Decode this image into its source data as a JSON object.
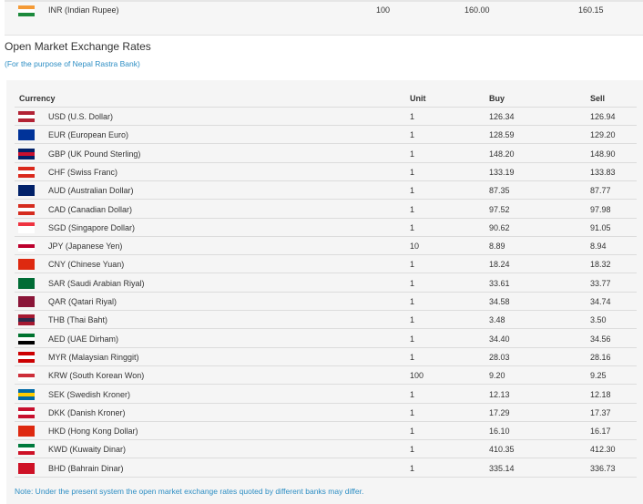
{
  "top_row": {
    "currency": "INR (Indian Rupee)",
    "unit": "100",
    "buy": "160.00",
    "sell": "160.15",
    "flag": [
      "#f49a36",
      "#ffffff",
      "#1c8a3c"
    ]
  },
  "title": "Open Market Exchange Rates",
  "subtitle": "(For the purpose of Nepal Rastra Bank)",
  "headers": {
    "currency": "Currency",
    "unit": "Unit",
    "buy": "Buy",
    "sell": "Sell"
  },
  "rows": [
    {
      "currency": "USD (U.S. Dollar)",
      "unit": "1",
      "buy": "126.34",
      "sell": "126.94",
      "flag": [
        "#b22234",
        "#ffffff",
        "#b22234"
      ]
    },
    {
      "currency": "EUR (European Euro)",
      "unit": "1",
      "buy": "128.59",
      "sell": "129.20",
      "flag": [
        "#003399",
        "#003399",
        "#003399"
      ]
    },
    {
      "currency": "GBP (UK Pound Sterling)",
      "unit": "1",
      "buy": "148.20",
      "sell": "148.90",
      "flag": [
        "#012169",
        "#c8102e",
        "#012169"
      ]
    },
    {
      "currency": "CHF (Swiss Franc)",
      "unit": "1",
      "buy": "133.19",
      "sell": "133.83",
      "flag": [
        "#da291c",
        "#ffffff",
        "#da291c"
      ]
    },
    {
      "currency": "AUD (Australian Dollar)",
      "unit": "1",
      "buy": "87.35",
      "sell": "87.77",
      "flag": [
        "#012169",
        "#012169",
        "#012169"
      ]
    },
    {
      "currency": "CAD (Canadian Dollar)",
      "unit": "1",
      "buy": "97.52",
      "sell": "97.98",
      "flag": [
        "#d52b1e",
        "#ffffff",
        "#d52b1e"
      ]
    },
    {
      "currency": "SGD (Singapore Dollar)",
      "unit": "1",
      "buy": "90.62",
      "sell": "91.05",
      "flag": [
        "#ef3340",
        "#ffffff",
        "#ffffff"
      ]
    },
    {
      "currency": "JPY (Japanese Yen)",
      "unit": "10",
      "buy": "8.89",
      "sell": "8.94",
      "flag": [
        "#ffffff",
        "#bc002d",
        "#ffffff"
      ]
    },
    {
      "currency": "CNY (Chinese Yuan)",
      "unit": "1",
      "buy": "18.24",
      "sell": "18.32",
      "flag": [
        "#de2910",
        "#de2910",
        "#de2910"
      ]
    },
    {
      "currency": "SAR (Saudi Arabian Riyal)",
      "unit": "1",
      "buy": "33.61",
      "sell": "33.77",
      "flag": [
        "#006c35",
        "#006c35",
        "#006c35"
      ]
    },
    {
      "currency": "QAR (Qatari Riyal)",
      "unit": "1",
      "buy": "34.58",
      "sell": "34.74",
      "flag": [
        "#8a1538",
        "#8a1538",
        "#8a1538"
      ]
    },
    {
      "currency": "THB (Thai Baht)",
      "unit": "1",
      "buy": "3.48",
      "sell": "3.50",
      "flag": [
        "#a51931",
        "#2d2a4a",
        "#a51931"
      ]
    },
    {
      "currency": "AED (UAE Dirham)",
      "unit": "1",
      "buy": "34.40",
      "sell": "34.56",
      "flag": [
        "#00732f",
        "#ffffff",
        "#000000"
      ]
    },
    {
      "currency": "MYR (Malaysian Ringgit)",
      "unit": "1",
      "buy": "28.03",
      "sell": "28.16",
      "flag": [
        "#cc0001",
        "#ffffff",
        "#cc0001"
      ]
    },
    {
      "currency": "KRW (South Korean Won)",
      "unit": "100",
      "buy": "9.20",
      "sell": "9.25",
      "flag": [
        "#ffffff",
        "#cd2e3a",
        "#ffffff"
      ]
    },
    {
      "currency": "SEK (Swedish Kroner)",
      "unit": "1",
      "buy": "12.13",
      "sell": "12.18",
      "flag": [
        "#006aa7",
        "#fecc00",
        "#006aa7"
      ]
    },
    {
      "currency": "DKK (Danish Kroner)",
      "unit": "1",
      "buy": "17.29",
      "sell": "17.37",
      "flag": [
        "#c8102e",
        "#ffffff",
        "#c8102e"
      ]
    },
    {
      "currency": "HKD (Hong Kong Dollar)",
      "unit": "1",
      "buy": "16.10",
      "sell": "16.17",
      "flag": [
        "#de2910",
        "#de2910",
        "#de2910"
      ]
    },
    {
      "currency": "KWD (Kuwaity Dinar)",
      "unit": "1",
      "buy": "410.35",
      "sell": "412.30",
      "flag": [
        "#007a3d",
        "#ffffff",
        "#ce1126"
      ]
    },
    {
      "currency": "BHD (Bahrain Dinar)",
      "unit": "1",
      "buy": "335.14",
      "sell": "336.73",
      "flag": [
        "#ce1126",
        "#ce1126",
        "#ce1126"
      ]
    }
  ],
  "note": "Note: Under the present system the open market exchange rates quoted by different banks may differ."
}
